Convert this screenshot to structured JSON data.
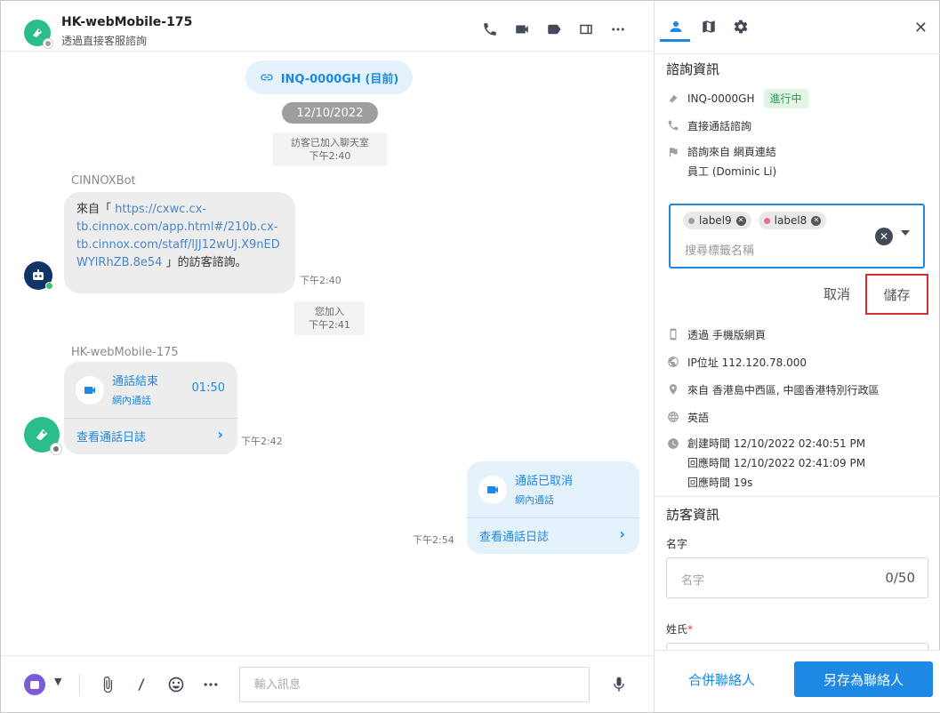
{
  "colors": {
    "accent": "#1e88e5",
    "green_avatar": "#2bbd8a",
    "bot_avatar": "#0f3466",
    "status_green": "#2e9a4b",
    "highlight_red": "#d32f2f"
  },
  "chat": {
    "header": {
      "title": "HK-webMobile-175",
      "subtitle": "透過直接客服諮詢",
      "icons": [
        "phone-icon",
        "video-icon",
        "label-icon",
        "split-view-icon",
        "more-icon"
      ]
    },
    "inquiry_pill": "INQ-0000GH (目前)",
    "date": "12/10/2022",
    "system_joined": {
      "text": "訪客已加入聊天室",
      "time": "下午2:40"
    },
    "bot": {
      "name": "CINNOXBot",
      "message_prefix": "來自「 ",
      "message_link": "https://cxwc.cx-tb.cinnox.com/app.html#/210b.cx-tb.cinnox.com/staff/lJJ12wUj.X9nEDWYlRhZB.8e54",
      "link_lines": [
        "https://cxwc.cx-",
        "tb.cinnox.com/app.html#/210b.cx-",
        "tb.cinnox.com/staff/lJJ12wUj.X9nED",
        "WYlRhZB.8e54"
      ],
      "message_suffix": " 」的訪客諮詢。",
      "time": "下午2:40"
    },
    "system_you_joined": {
      "text": "您加入",
      "time": "下午2:41"
    },
    "visitor": {
      "name": "HK-webMobile-175",
      "call": {
        "title": "通話結束",
        "subtitle": "網內通話",
        "duration": "01:50",
        "link": "查看通話日誌"
      },
      "time": "下午2:42"
    },
    "agent_call": {
      "title": "通話已取消",
      "subtitle": "網內通話",
      "link": "查看通話日誌",
      "time": "下午2:54"
    },
    "composer": {
      "placeholder": "輸入訊息"
    }
  },
  "panel": {
    "tabs": [
      "person-icon",
      "map-icon",
      "gear-icon"
    ],
    "inquiry_section": {
      "title": "諮詢資訊",
      "inquiry_id": "INQ-0000GH",
      "status": "進行中",
      "channel": "直接通話諮詢",
      "source_line": "諮詢來自 網頁連結",
      "staff_line": "員工 (Dominic Li)"
    },
    "labels": {
      "chips": [
        {
          "name": "label9",
          "color": "#9e9e9e"
        },
        {
          "name": "label8",
          "color": "#ec6a9c"
        }
      ],
      "placeholder": "搜尋標籤名稱",
      "cancel": "取消",
      "save": "儲存"
    },
    "details": {
      "device": "透過 手機版網頁",
      "ip": "IP位址 112.120.78.000",
      "location": "來自 香港島中西區, 中國香港特別行政區",
      "language": "英語",
      "created": "創建時間 12/10/2022 02:40:51 PM",
      "responded": "回應時間 12/10/2022 02:41:09 PM",
      "response_duration": "回應時間 19s"
    },
    "visitor_section": {
      "title": "訪客資訊",
      "first_name_label": "名字",
      "first_name_placeholder": "名字",
      "first_name_count": "0/50",
      "last_name_label": "姓氏",
      "last_name_required": "*"
    },
    "footer": {
      "merge": "合併聯絡人",
      "save_as": "另存為聯絡人"
    }
  }
}
